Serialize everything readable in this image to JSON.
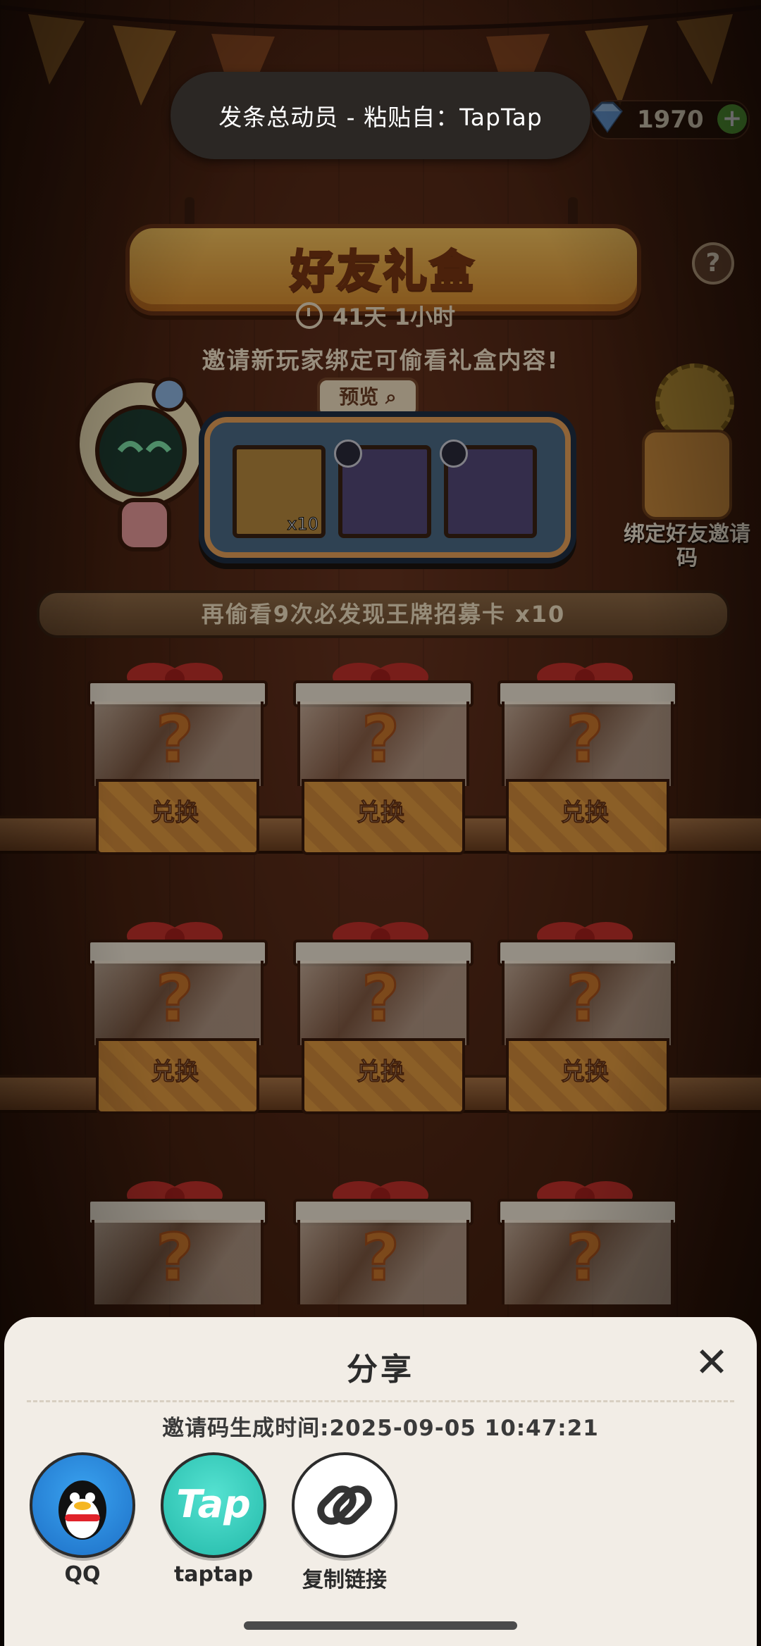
{
  "toast": {
    "text": "发条总动员 - 粘贴自：TapTap"
  },
  "currency": {
    "amount": "1970",
    "plus": "+"
  },
  "event": {
    "title": "好友礼盒",
    "countdown": "41天 1小时",
    "subtitle": "邀请新玩家绑定可偷看礼盒内容!",
    "preview_label": "预览",
    "help": "?"
  },
  "rewards": [
    {
      "name": "card-pack",
      "count": "x10"
    },
    {
      "name": "magic-wand",
      "count": ""
    },
    {
      "name": "ring",
      "count": ""
    }
  ],
  "bind": {
    "label": "绑定好友邀请码"
  },
  "progress": {
    "text": "再偷看9次必发现王牌招募卡 x10"
  },
  "boxes": {
    "redeem_label": "兑换",
    "question": "?"
  },
  "share": {
    "title": "分享",
    "close": "✕",
    "generated": "邀请码生成时间:2025-09-05  10:47:21",
    "options": [
      {
        "label": "QQ",
        "icon": "qq-icon"
      },
      {
        "label": "taptap",
        "icon": "taptap-icon",
        "logo": "Tap"
      },
      {
        "label": "复制链接",
        "icon": "link-icon"
      }
    ]
  },
  "colors": {
    "toast_bg": "#2b2724",
    "sheet_bg": "#f2ede6",
    "accent": "#e09a3f"
  }
}
